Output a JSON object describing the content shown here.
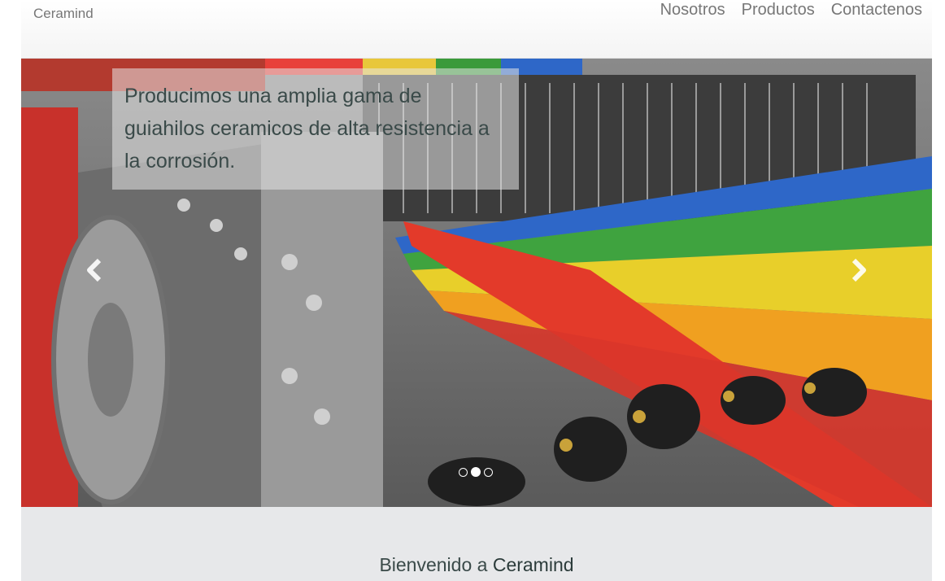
{
  "navbar": {
    "brand": "Ceramind",
    "links": [
      {
        "label": "Nosotros"
      },
      {
        "label": "Productos"
      },
      {
        "label": "Contactenos"
      }
    ]
  },
  "carousel": {
    "caption": "Producimos una amplia gama de guiahilos ceramicos de alta resistencia a la corrosión.",
    "prev_icon": "chevron-left-icon",
    "next_icon": "chevron-right-icon",
    "indicators": {
      "count": 3,
      "active": 1
    }
  },
  "welcome": {
    "prefix": "Bienvenido a",
    "brand": "Ceramind"
  },
  "colors": {
    "text_dark": "#3a4a49",
    "nav_text": "#777777",
    "welcome_bg": "#e7e8ea"
  }
}
